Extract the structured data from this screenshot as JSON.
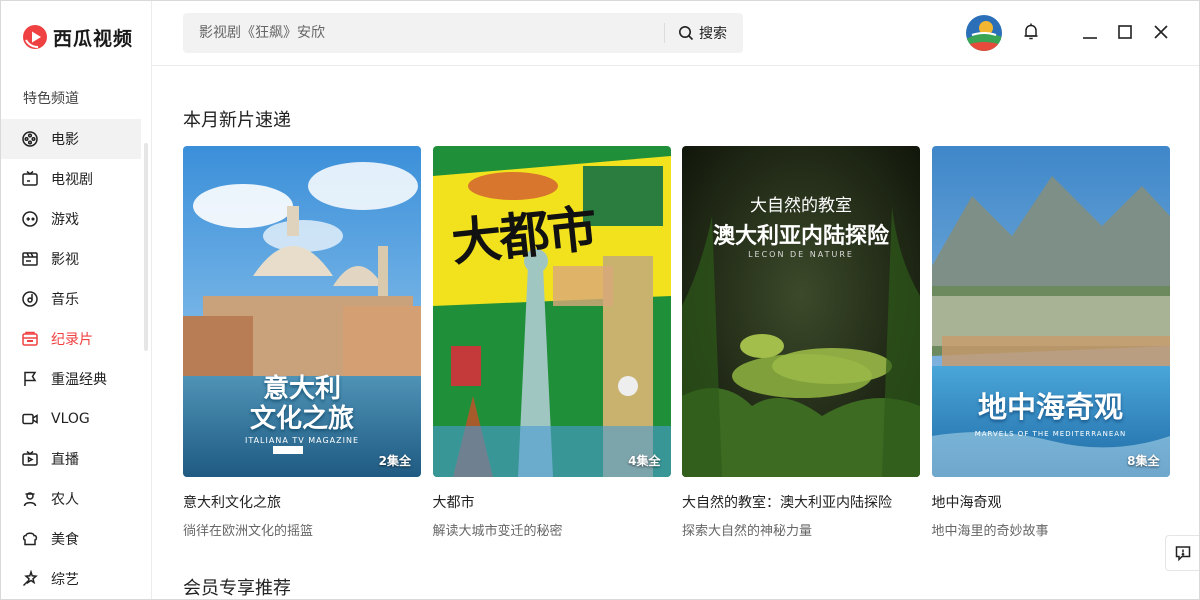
{
  "app": {
    "name": "西瓜视频",
    "brand_color": "#f04142"
  },
  "sidebar": {
    "section_title": "特色频道",
    "items": [
      {
        "label": "电影",
        "icon": "film-reel-icon"
      },
      {
        "label": "电视剧",
        "icon": "tv-icon"
      },
      {
        "label": "游戏",
        "icon": "gamepad-icon"
      },
      {
        "label": "影视",
        "icon": "clapperboard-icon"
      },
      {
        "label": "音乐",
        "icon": "music-disc-icon"
      },
      {
        "label": "纪录片",
        "icon": "documentary-icon"
      },
      {
        "label": "重温经典",
        "icon": "flag-icon"
      },
      {
        "label": "VLOG",
        "icon": "camera-icon"
      },
      {
        "label": "直播",
        "icon": "live-tv-icon"
      },
      {
        "label": "农人",
        "icon": "farmer-icon"
      },
      {
        "label": "美食",
        "icon": "food-icon"
      },
      {
        "label": "综艺",
        "icon": "variety-star-icon"
      }
    ]
  },
  "header": {
    "search_placeholder": "影视剧《狂飙》安欣",
    "search_button": "搜索"
  },
  "main": {
    "section1_title": "本月新片速递",
    "section2_title": "会员专享推荐",
    "cards": [
      {
        "title": "意大利文化之旅",
        "subtitle": "徜徉在欧洲文化的摇篮",
        "episodes": "2集全",
        "poster_title_line1": "意大利",
        "poster_title_line2": "文化之旅",
        "poster_caption": "ITALIANA TV MAGAZINE"
      },
      {
        "title": "大都市",
        "subtitle": "解读大城市变迁的秘密",
        "episodes": "4集全",
        "poster_title": "大都市"
      },
      {
        "title": "大自然的教室：澳大利亚内陆探险",
        "subtitle": "探索大自然的神秘力量",
        "episodes": "",
        "poster_line1": "大自然的教室",
        "poster_line2": "澳大利亚内陆探险",
        "poster_caption": "LECON DE NATURE"
      },
      {
        "title": "地中海奇观",
        "subtitle": "地中海里的奇妙故事",
        "episodes": "8集全",
        "poster_title": "地中海奇观",
        "poster_caption": "MARVELS OF THE MEDITERRANEAN"
      }
    ]
  }
}
